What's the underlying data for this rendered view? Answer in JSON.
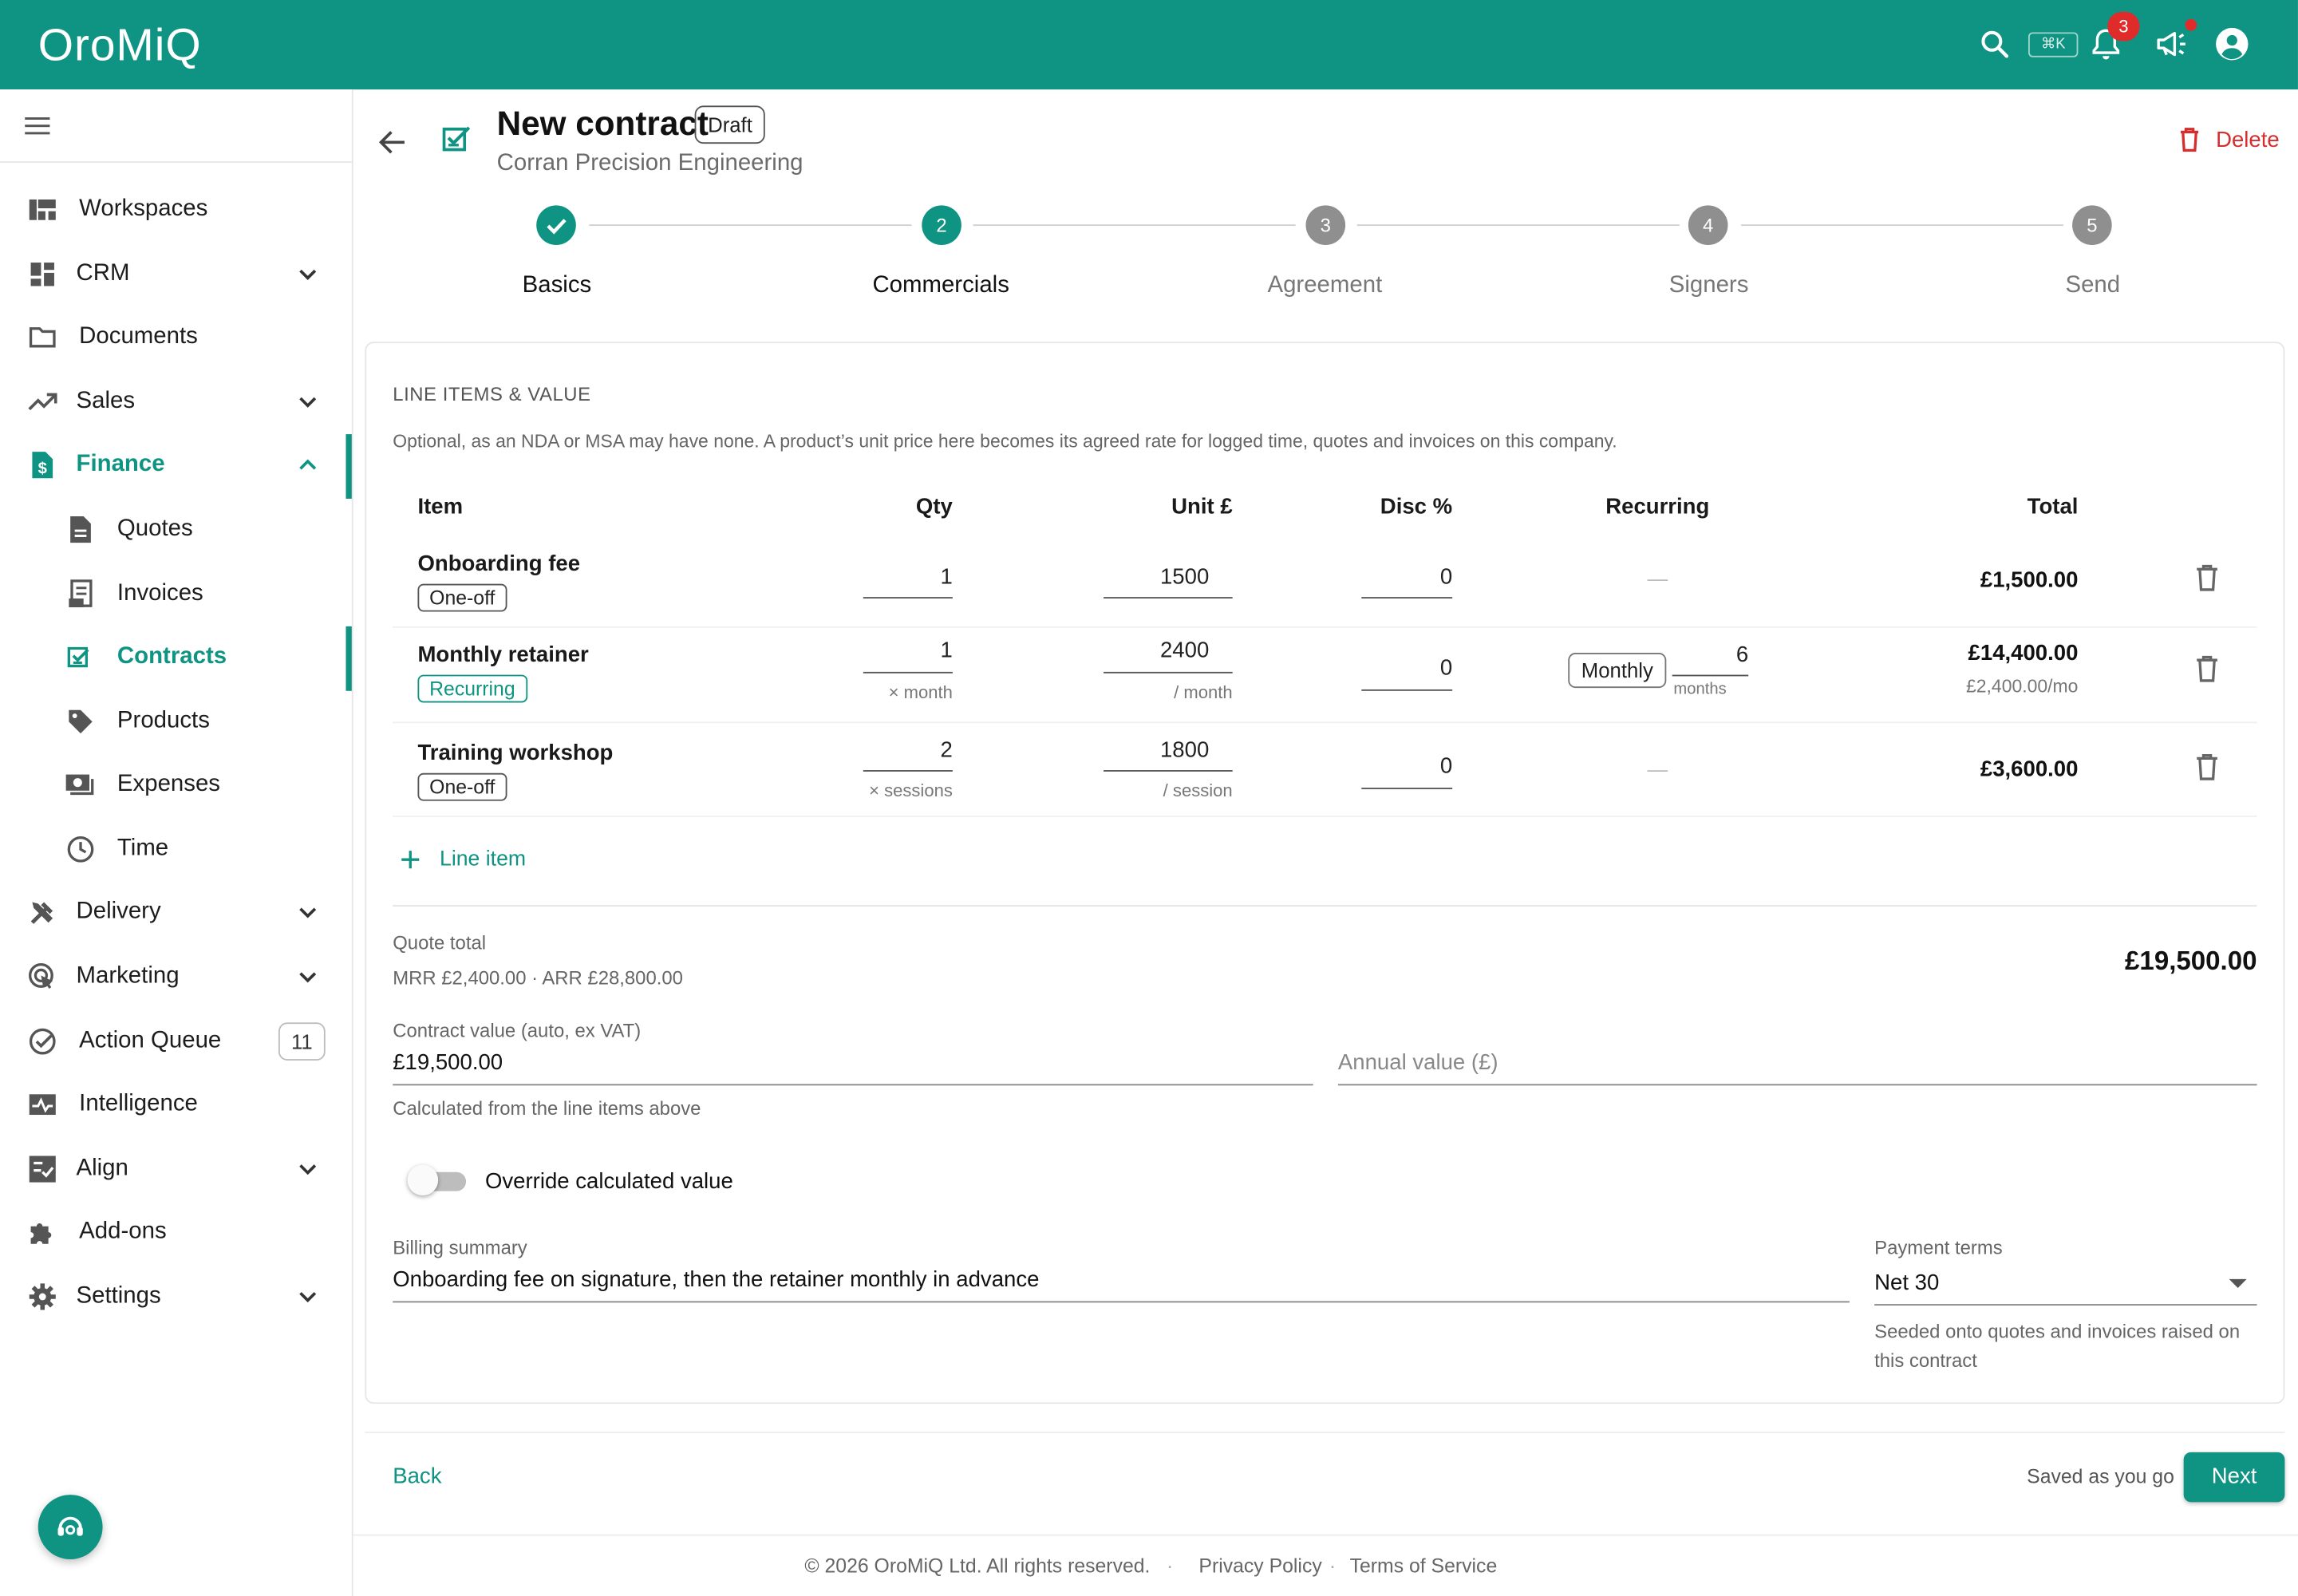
{
  "app": {
    "brand": "OroMiQ",
    "accent": "#0f9483",
    "danger": "#d32f2f"
  },
  "topbar": {
    "search_icon": "search-icon",
    "shortcut": "⌘K",
    "notification_count": "3",
    "announce_icon": "megaphone-icon",
    "account_icon": "account-icon"
  },
  "sidebar": {
    "items": [
      {
        "label": "Workspaces",
        "icon": "workspaces-icon"
      },
      {
        "label": "CRM",
        "icon": "dashboard-icon"
      },
      {
        "label": "Documents",
        "icon": "folder-icon"
      },
      {
        "label": "Sales",
        "icon": "trending-icon"
      },
      {
        "label": "Finance",
        "icon": "finance-icon"
      },
      {
        "label": "Quotes",
        "icon": "quote-doc-icon"
      },
      {
        "label": "Invoices",
        "icon": "invoice-icon"
      },
      {
        "label": "Contracts",
        "icon": "contract-icon"
      },
      {
        "label": "Products",
        "icon": "tag-icon"
      },
      {
        "label": "Expenses",
        "icon": "expenses-icon"
      },
      {
        "label": "Time",
        "icon": "clock-icon"
      },
      {
        "label": "Delivery",
        "icon": "tools-icon"
      },
      {
        "label": "Marketing",
        "icon": "target-icon"
      },
      {
        "label": "Action Queue",
        "icon": "check-circle-icon"
      },
      {
        "label": "Intelligence",
        "icon": "pulse-icon"
      },
      {
        "label": "Align",
        "icon": "checklist-icon"
      },
      {
        "label": "Add-ons",
        "icon": "puzzle-icon"
      },
      {
        "label": "Settings",
        "icon": "gear-icon"
      }
    ],
    "action_queue_count": "11"
  },
  "header": {
    "title": "New contract",
    "status": "Draft",
    "subtitle": "Corran Precision Engineering",
    "delete_label": "Delete"
  },
  "stepper": {
    "steps": [
      {
        "num": "1",
        "label": "Basics",
        "state": "done"
      },
      {
        "num": "2",
        "label": "Commercials",
        "state": "active"
      },
      {
        "num": "3",
        "label": "Agreement",
        "state": "pending"
      },
      {
        "num": "4",
        "label": "Signers",
        "state": "pending"
      },
      {
        "num": "5",
        "label": "Send",
        "state": "pending"
      }
    ]
  },
  "line_items": {
    "section_title": "LINE ITEMS & VALUE",
    "description": "Optional, as an NDA or MSA may have none. A product’s unit price here becomes its agreed rate for logged time, quotes and invoices on this company.",
    "headers": {
      "item": "Item",
      "qty": "Qty",
      "unit": "Unit £",
      "disc": "Disc %",
      "recurring": "Recurring",
      "total": "Total"
    },
    "rows": [
      {
        "name": "Onboarding fee",
        "type": "One-off",
        "qty": "1",
        "qty_unit": "",
        "unit_price": "1500",
        "unit_per": "",
        "disc": "0",
        "recurring": "—",
        "total": "£1,500.00",
        "total_sub": ""
      },
      {
        "name": "Monthly retainer",
        "type": "Recurring",
        "qty": "1",
        "qty_unit": "× month",
        "unit_price": "2400",
        "unit_per": "/ month",
        "disc": "0",
        "recurring_period": "Monthly",
        "recurring_months": "6",
        "recurring_months_label": "months",
        "total": "£14,400.00",
        "total_sub": "£2,400.00/mo"
      },
      {
        "name": "Training workshop",
        "type": "One-off",
        "qty": "2",
        "qty_unit": "× sessions",
        "unit_price": "1800",
        "unit_per": "/ session",
        "disc": "0",
        "recurring": "—",
        "total": "£3,600.00",
        "total_sub": ""
      }
    ],
    "add_label": "Line item"
  },
  "totals": {
    "quote_total_label": "Quote total",
    "mrr_arr": "MRR £2,400.00 · ARR £28,800.00",
    "quote_total": "£19,500.00",
    "contract_value_label": "Contract value (auto, ex VAT)",
    "contract_value": "£19,500.00",
    "contract_value_help": "Calculated from the line items above",
    "annual_value_placeholder": "Annual value (£)"
  },
  "override": {
    "label": "Override calculated value",
    "enabled": false
  },
  "billing": {
    "summary_label": "Billing summary",
    "summary": "Onboarding fee on signature, then the retainer monthly in advance",
    "terms_label": "Payment terms",
    "terms": "Net 30",
    "terms_help_1": "Seeded onto quotes and invoices raised on",
    "terms_help_2": "this contract"
  },
  "actions": {
    "back": "Back",
    "saved": "Saved as you go",
    "next": "Next"
  },
  "footer": {
    "copyright": "© 2026 OroMiQ Ltd. All rights reserved.",
    "sep": "·",
    "privacy": "Privacy Policy",
    "terms": "Terms of Service"
  }
}
